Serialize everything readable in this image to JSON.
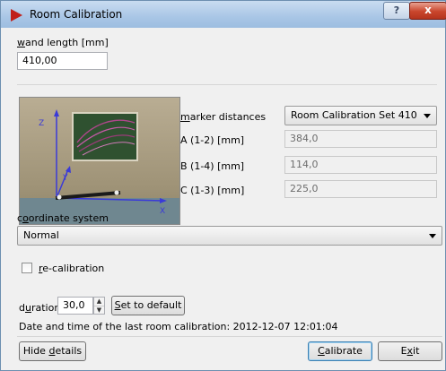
{
  "window": {
    "title": "Room Calibration",
    "help_label": "?",
    "close_label": "x"
  },
  "wand": {
    "label_pre": "",
    "label_accel": "w",
    "label_post": "and length [mm]",
    "value": "410,00"
  },
  "marker": {
    "label_pre": "",
    "label_accel": "m",
    "label_post": "arker distances",
    "selected": "Room Calibration Set 410",
    "rows": [
      {
        "label": "A (1-2) [mm]",
        "value": "384,0"
      },
      {
        "label": "B (1-4) [mm]",
        "value": "114,0"
      },
      {
        "label": "C (1-3) [mm]",
        "value": "225,0"
      }
    ]
  },
  "photo": {
    "axis_z": "Z",
    "axis_y": "Y",
    "axis_x": "X"
  },
  "coordinate": {
    "label_pre": "c",
    "label_accel": "o",
    "label_post": "ordinate system",
    "selected": "Normal"
  },
  "recalibration": {
    "label_pre": "",
    "label_accel": "r",
    "label_post": "e-calibration",
    "checked": false
  },
  "duration": {
    "label_pre": "d",
    "label_accel": "u",
    "label_post": "ration",
    "value": "30,0",
    "set_default_pre": "",
    "set_default_accel": "S",
    "set_default_post": "et to default"
  },
  "last_calibration": "Date and time of the last room calibration: 2012-12-07 12:01:04",
  "buttons": {
    "hide_pre": "Hide ",
    "hide_accel": "d",
    "hide_post": "etails",
    "calibrate_pre": "",
    "calibrate_accel": "C",
    "calibrate_post": "alibrate",
    "exit_pre": "E",
    "exit_accel": "x",
    "exit_post": "it"
  },
  "colors": {
    "titlebar": "#a9c6e6",
    "close": "#c9452c",
    "accent_red": "#c0201b",
    "axis_blue": "#3a3ad8"
  }
}
